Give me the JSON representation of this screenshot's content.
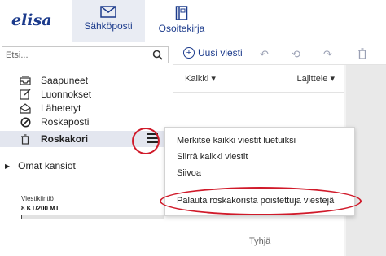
{
  "brand": {
    "logo_text": "elisa",
    "accent": "#1c3b8c",
    "highlight": "#d01a2a"
  },
  "nav": {
    "mail_label": "Sähköposti",
    "contacts_label": "Osoitekirja"
  },
  "search": {
    "placeholder": "Etsi..."
  },
  "folders": [
    {
      "label": "Saapuneet",
      "icon": "inbox-icon"
    },
    {
      "label": "Luonnokset",
      "icon": "edit-icon"
    },
    {
      "label": "Lähetetyt",
      "icon": "sent-icon"
    },
    {
      "label": "Roskaposti",
      "icon": "block-icon"
    },
    {
      "label": "Roskakori",
      "icon": "trash-icon",
      "selected": true
    }
  ],
  "own_folders": {
    "label": "Omat kansiot"
  },
  "quota": {
    "label": "Viestikiintiö",
    "value": "8 KT/200 MT",
    "used_fraction": 0.0
  },
  "toolbar": {
    "new_message_label": "Uusi viesti"
  },
  "list": {
    "filter_label": "Kaikki",
    "sort_label": "Lajittele",
    "empty_text": "Tyhjä"
  },
  "context_menu": {
    "items": [
      "Merkitse kaikki viestit luetuiksi",
      "Siirrä kaikki viestit",
      "Siivoa",
      "Palauta roskakorista poistettuja viestejä"
    ]
  }
}
